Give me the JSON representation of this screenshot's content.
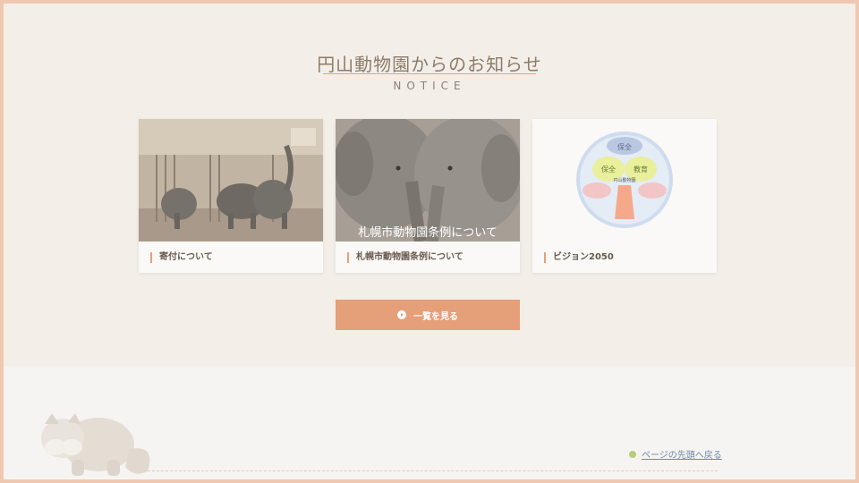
{
  "section": {
    "title": "円山動物園からのお知らせ",
    "subtitle": "NOTICE"
  },
  "cards": [
    {
      "label": "寄付について",
      "image": "elephants-indoor-photo"
    },
    {
      "label": "札幌市動物園条例について",
      "image": "two-elephants-photo",
      "image_caption": "札幌市動物園条例について"
    },
    {
      "label": "ビジョン2050",
      "image": "vision-2050-diagram",
      "diagram_top": "保全",
      "diagram_left": "保全",
      "diagram_right": "教育",
      "diagram_center": "円山動物園"
    }
  ],
  "button": {
    "label": "一覧を見る"
  },
  "footer": {
    "page_top_label": "ページの先頭へ戻る"
  },
  "colors": {
    "accent": "#e59f79",
    "background": "#f3efe8",
    "border": "#f0c7b0",
    "link": "#6c8aa4"
  }
}
